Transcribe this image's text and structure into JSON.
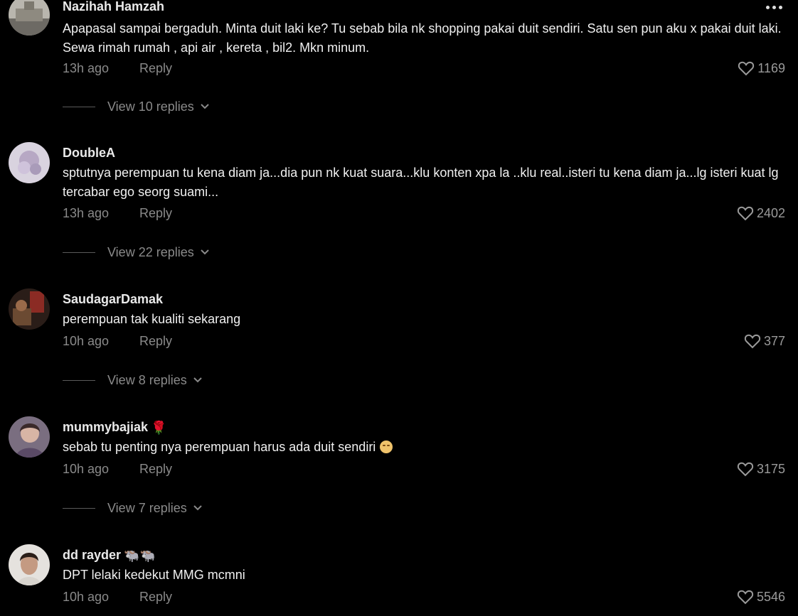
{
  "comments": [
    {
      "username": "Nazihah Hamzah",
      "text": "Apapasal sampai bergaduh. Minta duit laki ke? Tu sebab bila nk shopping pakai duit sendiri. Satu sen pun aku x pakai duit laki. Sewa rimah rumah , api air , kereta , bil2. Mkn minum.",
      "time": "13h ago",
      "reply": "Reply",
      "likes": "1169",
      "view_replies": "View 10 replies",
      "avatar_color": "#8a8a88"
    },
    {
      "username": "DoubleA",
      "text": "sptutnya perempuan tu kena diam ja...dia pun nk kuat suara...klu konten xpa la ..klu real..isteri tu kena diam ja...lg isteri kuat lg tercabar ego seorg suami...",
      "time": "13h ago",
      "reply": "Reply",
      "likes": "2402",
      "view_replies": "View 22 replies",
      "avatar_color": "#c9bfd4"
    },
    {
      "username": "SaudagarDamak",
      "text": "perempuan tak kualiti sekarang",
      "time": "10h ago",
      "reply": "Reply",
      "likes": "377",
      "view_replies": "View 8 replies",
      "avatar_color": "#5a3a2a"
    },
    {
      "username": "mummybajiak",
      "badge": "🌹",
      "text": "sebab tu penting nya perempuan harus ada duit sendiri",
      "time": "10h ago",
      "reply": "Reply",
      "likes": "3175",
      "view_replies": "View 7 replies",
      "avatar_color": "#9a8a9e"
    },
    {
      "username": "dd rayder",
      "badge": "🐃🐃",
      "text": "DPT lelaki kedekut MMG mcmni",
      "time": "10h ago",
      "reply": "Reply",
      "likes": "5546",
      "avatar_color": "#d8d2cc"
    }
  ],
  "icons": {
    "heart": "heart-icon",
    "more": "more-options-icon",
    "chevron": "chevron-down-icon"
  },
  "colors": {
    "background": "#000000",
    "muted_text": "#8a8a8a"
  }
}
